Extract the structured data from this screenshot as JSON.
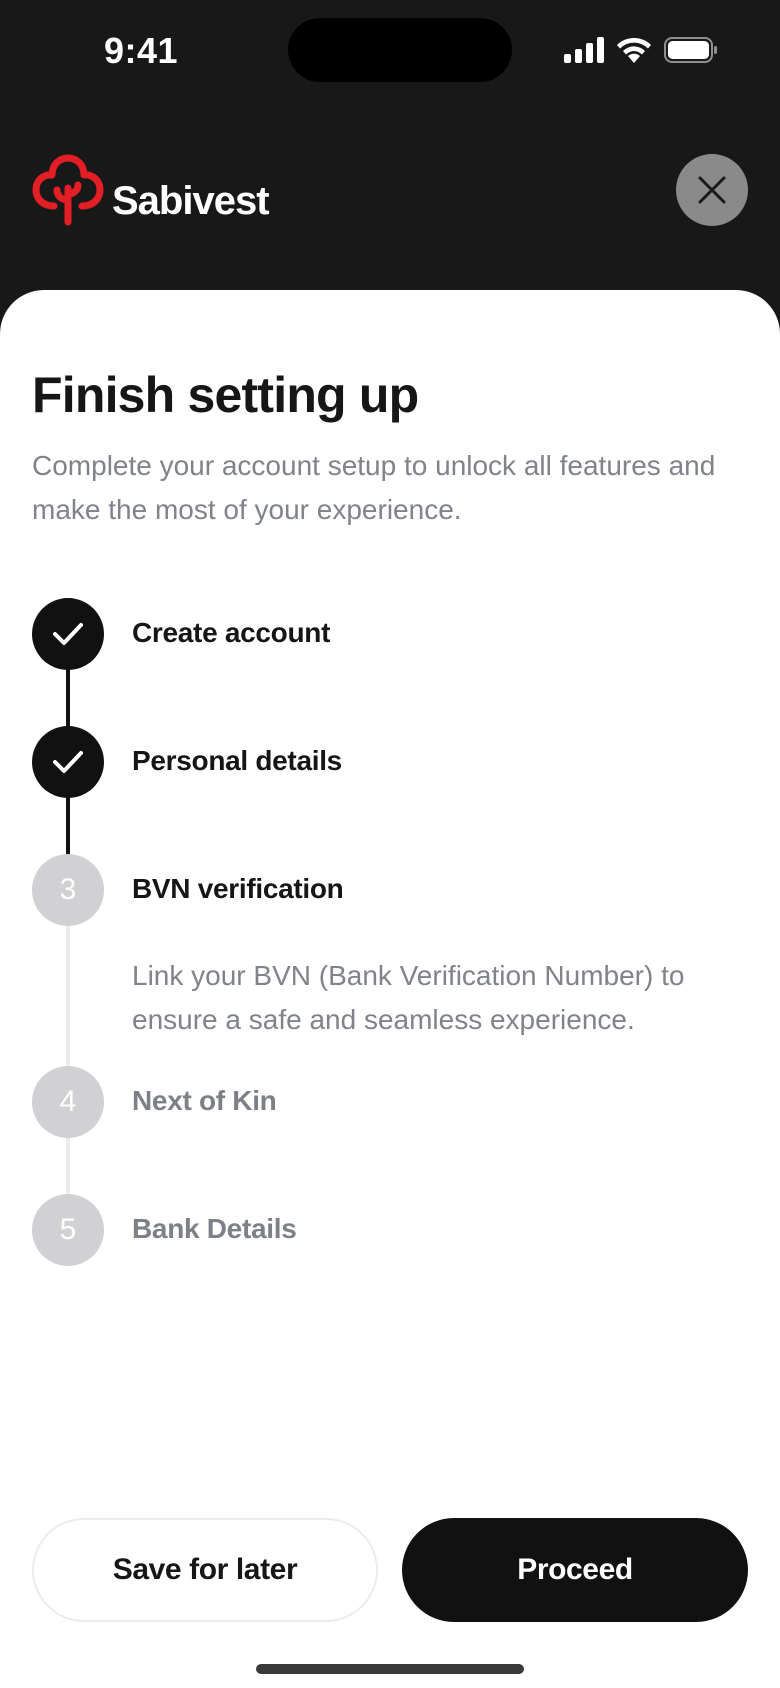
{
  "status_bar": {
    "time": "9:41",
    "icons": [
      "cellular-signal-icon",
      "wifi-icon",
      "battery-icon"
    ]
  },
  "header": {
    "brand_name": "Sabivest",
    "logo_icon": "sabivest-tree-logo",
    "close_icon": "close-icon"
  },
  "sheet": {
    "title": "Finish setting up",
    "subtitle": "Complete your account setup to unlock all features and make the most of your experience."
  },
  "steps": [
    {
      "label": "Create account",
      "status": "complete",
      "indicator": "check-icon"
    },
    {
      "label": "Personal details",
      "status": "complete",
      "indicator": "check-icon"
    },
    {
      "number": "3",
      "label": "BVN verification",
      "status": "current",
      "description": "Link your BVN (Bank Verification Number) to ensure a safe and seamless experience."
    },
    {
      "number": "4",
      "label": "Next of Kin",
      "status": "pending"
    },
    {
      "number": "5",
      "label": "Bank Details",
      "status": "pending"
    }
  ],
  "actions": {
    "save_later_label": "Save for later",
    "proceed_label": "Proceed"
  },
  "colors": {
    "header_bg": "#181818",
    "brand_red": "#e31e24",
    "primary": "#111111",
    "muted_text": "#80838a",
    "pending_circle": "#d1d1d3"
  }
}
